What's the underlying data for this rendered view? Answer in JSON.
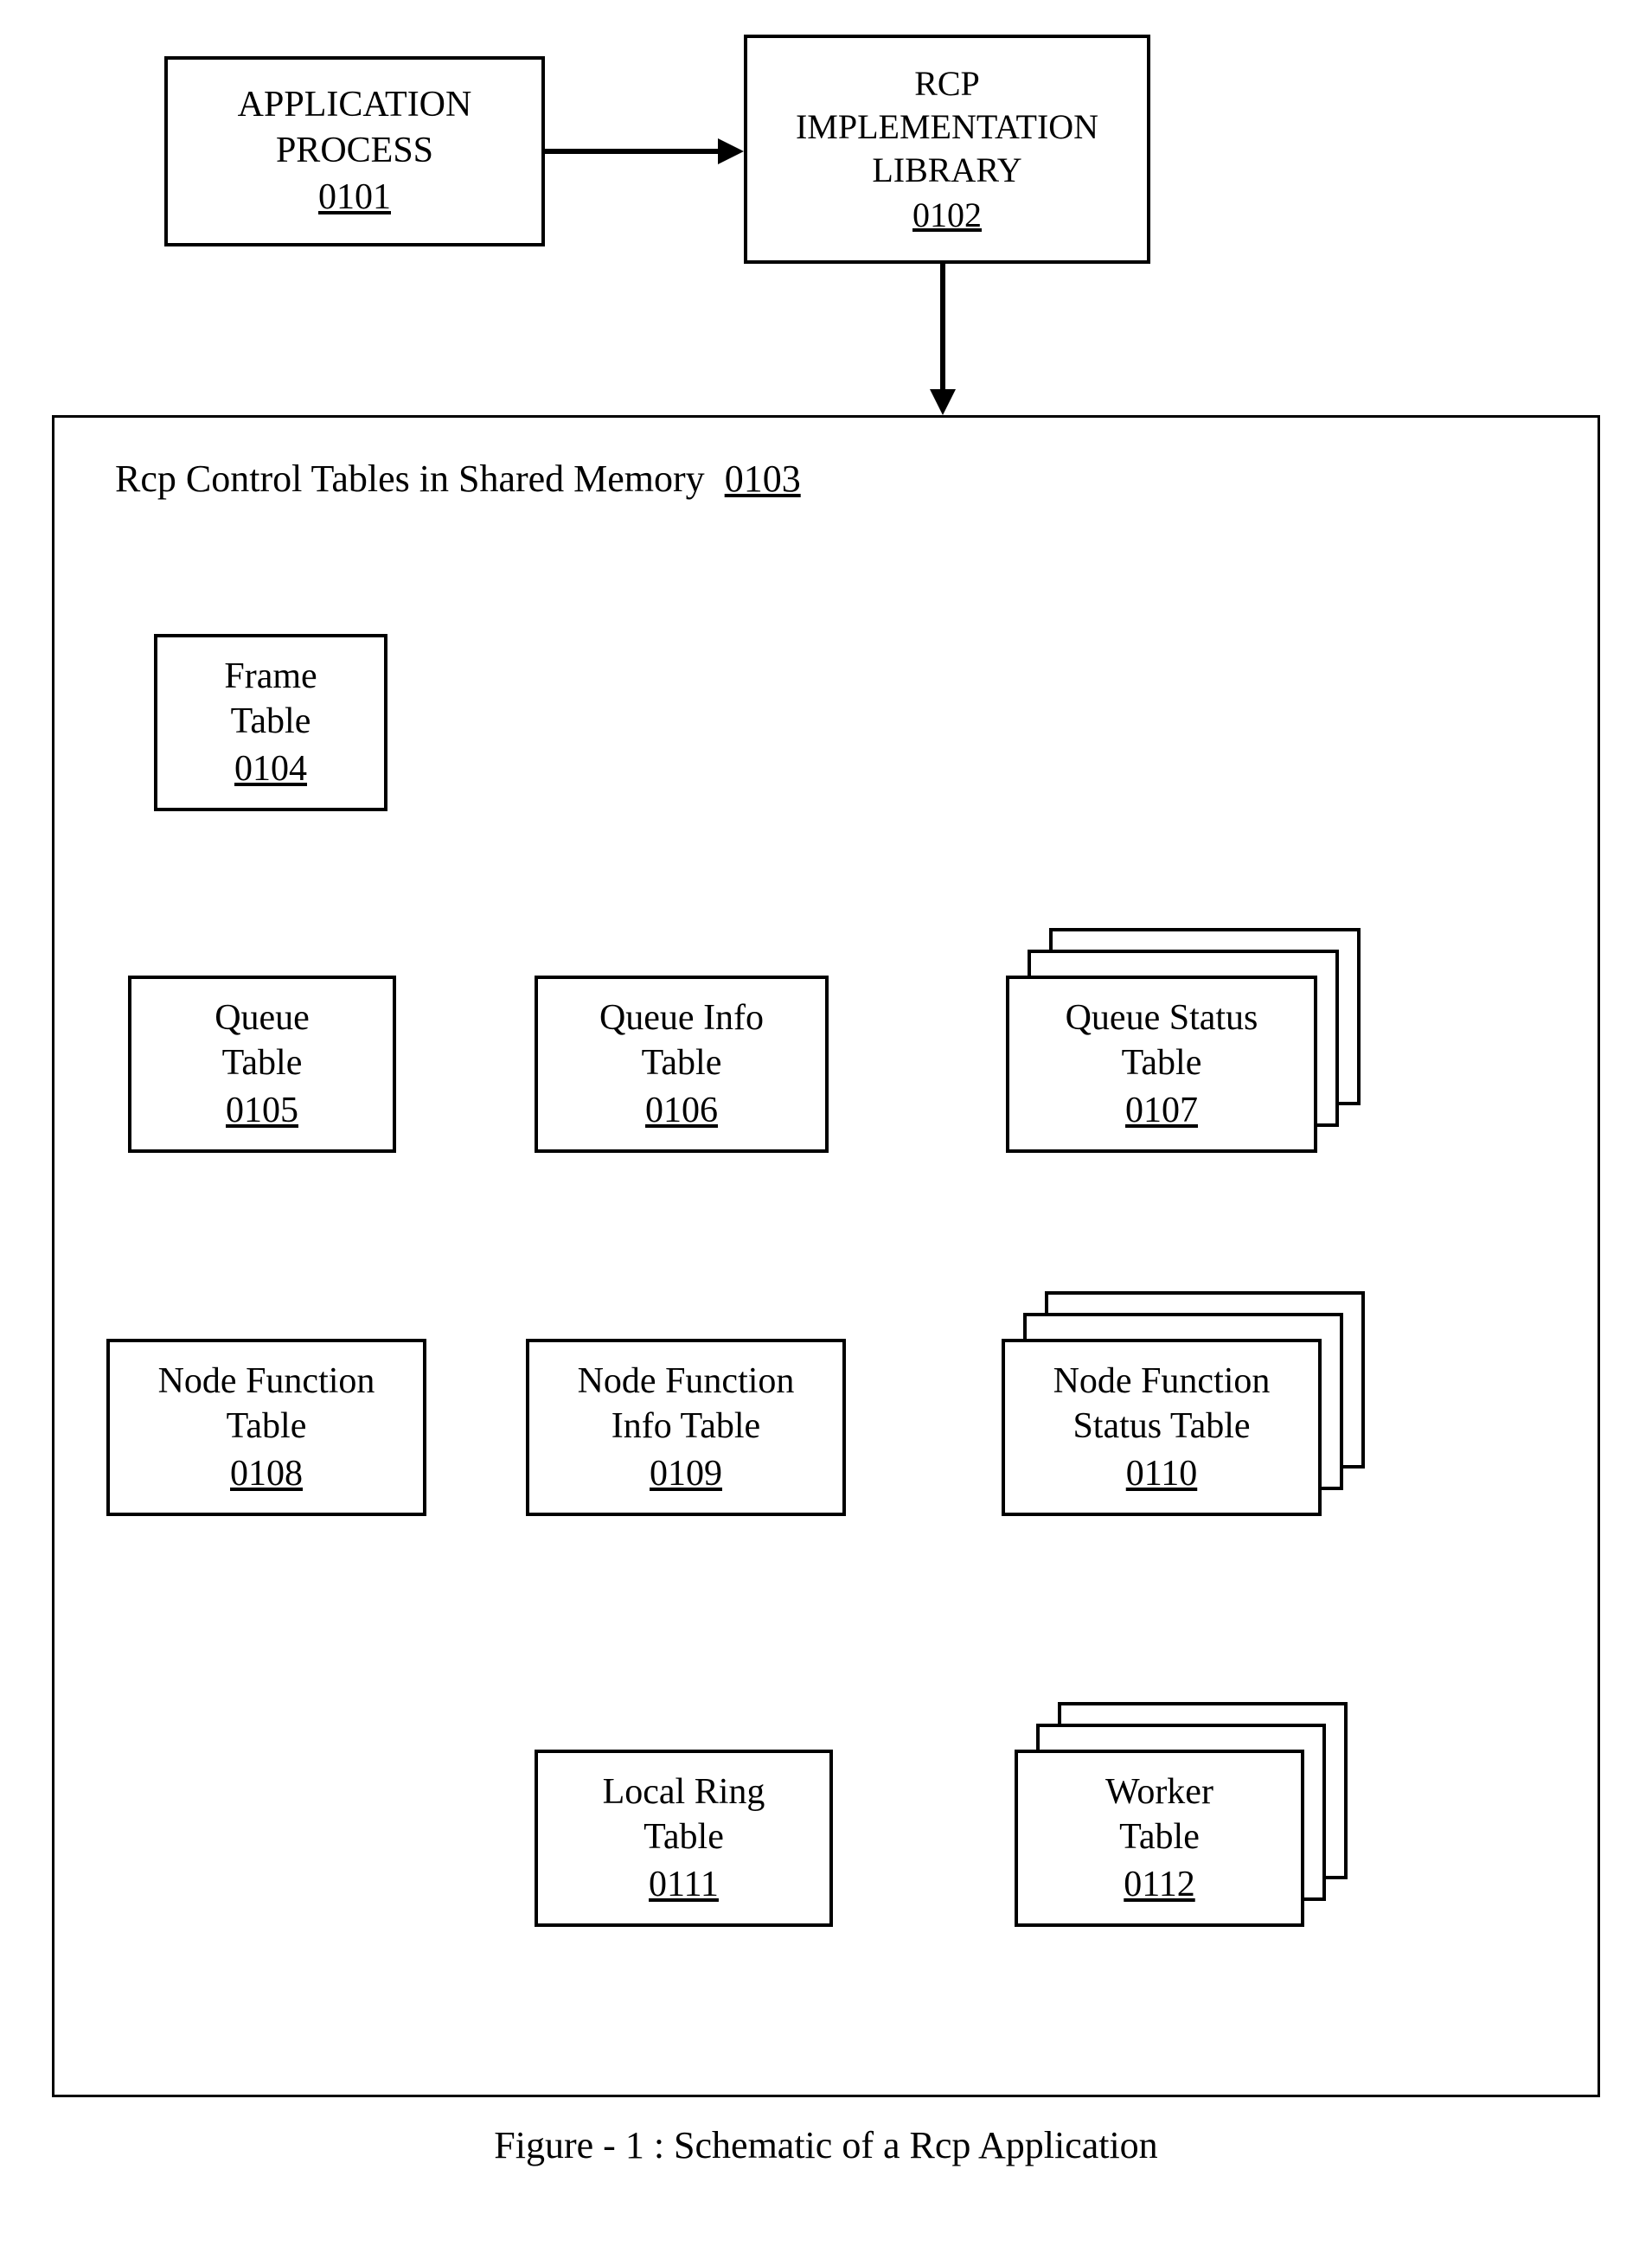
{
  "top": {
    "app_process": {
      "l1": "APPLICATION",
      "l2": "PROCESS",
      "ref": "0101"
    },
    "rcp_lib": {
      "l1": "RCP",
      "l2": "IMPLEMENTATION",
      "l3": "LIBRARY",
      "ref": "0102"
    }
  },
  "container": {
    "title_text": "Rcp Control Tables in Shared Memory",
    "title_ref": "0103"
  },
  "tables": {
    "frame": {
      "l1": "Frame",
      "l2": "Table",
      "ref": "0104"
    },
    "queue": {
      "l1": "Queue",
      "l2": "Table",
      "ref": "0105"
    },
    "queue_info": {
      "l1": "Queue Info",
      "l2": "Table",
      "ref": "0106"
    },
    "queue_status": {
      "l1": "Queue Status",
      "l2": "Table",
      "ref": "0107"
    },
    "node_fn": {
      "l1": "Node Function",
      "l2": "Table",
      "ref": "0108"
    },
    "node_fn_info": {
      "l1": "Node Function",
      "l2": "Info Table",
      "ref": "0109"
    },
    "node_fn_status": {
      "l1": "Node Function",
      "l2": "Status Table",
      "ref": "0110"
    },
    "local_ring": {
      "l1": "Local Ring",
      "l2": "Table",
      "ref": "0111"
    },
    "worker": {
      "l1": "Worker",
      "l2": "Table",
      "ref": "0112"
    }
  },
  "caption": "Figure - 1 : Schematic of a Rcp Application"
}
